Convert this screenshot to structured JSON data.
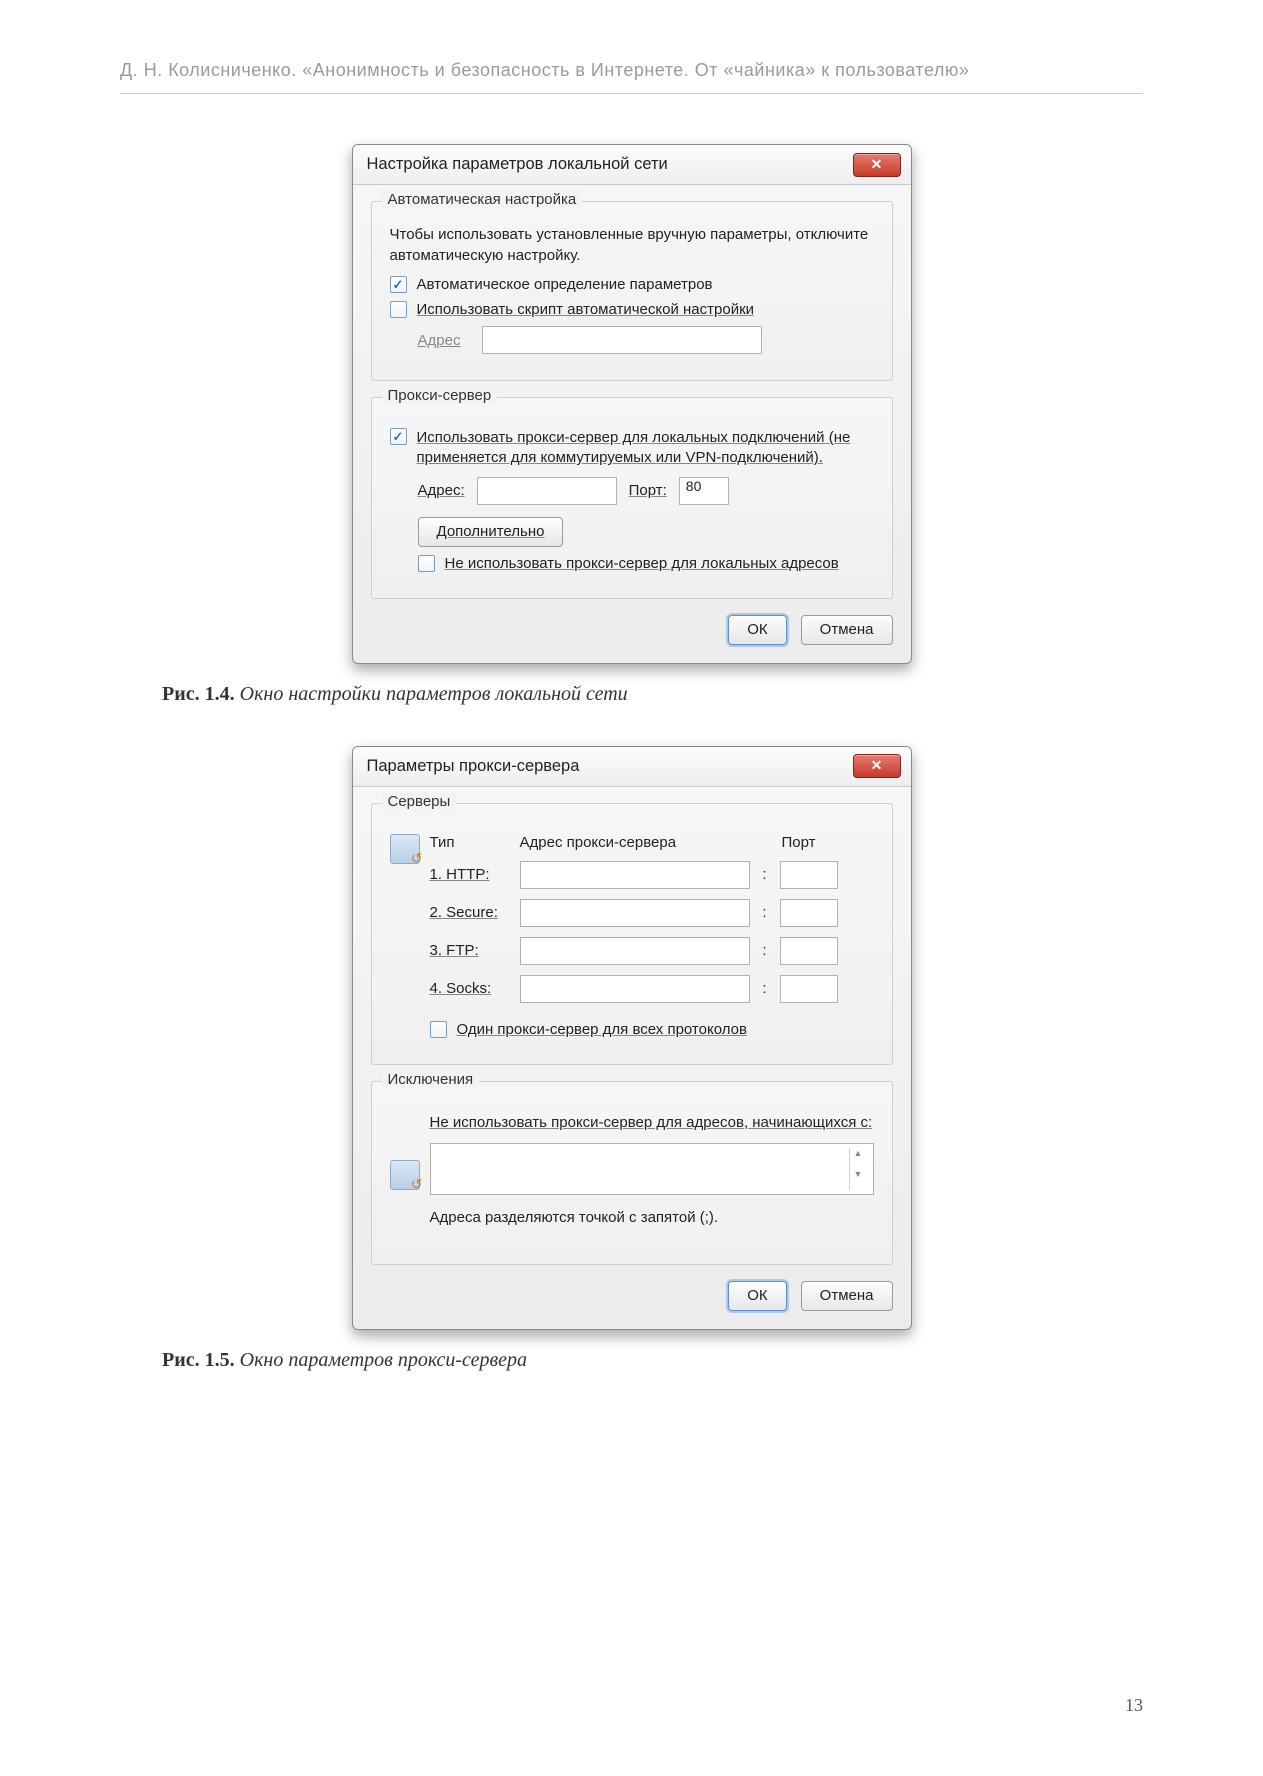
{
  "page_header": "Д.  Н.  Колисниченко.  «Анонимность и безопасность в Интернете. От «чайника» к пользователю»",
  "page_number": "13",
  "dialog1": {
    "title": "Настройка параметров локальной сети",
    "close_x": "✕",
    "group_auto": {
      "legend": "Автоматическая настройка",
      "desc": "Чтобы использовать установленные вручную параметры, отключите автоматическую настройку.",
      "chk_autodetect": "Автоматическое определение параметров",
      "chk_usescript": "Использовать скрипт автоматической настройки",
      "addr_label": "Адрес"
    },
    "group_proxy": {
      "legend": "Прокси-сервер",
      "chk_useproxy": "Использовать прокси-сервер для локальных подключений (не применяется для коммутируемых или VPN-подключений).",
      "addr_label": "Адрес:",
      "port_label": "Порт:",
      "port_value": "80",
      "adv_button": "Дополнительно",
      "chk_bypass_local": "Не использовать прокси-сервер для локальных адресов"
    },
    "ok": "ОК",
    "cancel": "Отмена"
  },
  "caption1_prefix": "Рис. 1.4.",
  "caption1_text": " Окно настройки параметров локальной сети",
  "dialog2": {
    "title": "Параметры прокси-сервера",
    "close_x": "✕",
    "servers_legend": "Серверы",
    "col_type": "Тип",
    "col_addr": "Адрес прокси-сервера",
    "col_port": "Порт",
    "rows": [
      {
        "type": "1. HTTP:"
      },
      {
        "type": "2. Secure:"
      },
      {
        "type": "3. FTP:"
      },
      {
        "type": "4. Socks:"
      }
    ],
    "chk_one_for_all": "Один прокси-сервер для всех протоколов",
    "excl_legend": "Исключения",
    "excl_desc": "Не использовать прокси-сервер для адресов, начинающихся с:",
    "excl_hint": "Адреса разделяются точкой с запятой (;).",
    "ok": "ОК",
    "cancel": "Отмена"
  },
  "caption2_prefix": "Рис. 1.5.",
  "caption2_text": " Окно параметров прокси-сервера"
}
